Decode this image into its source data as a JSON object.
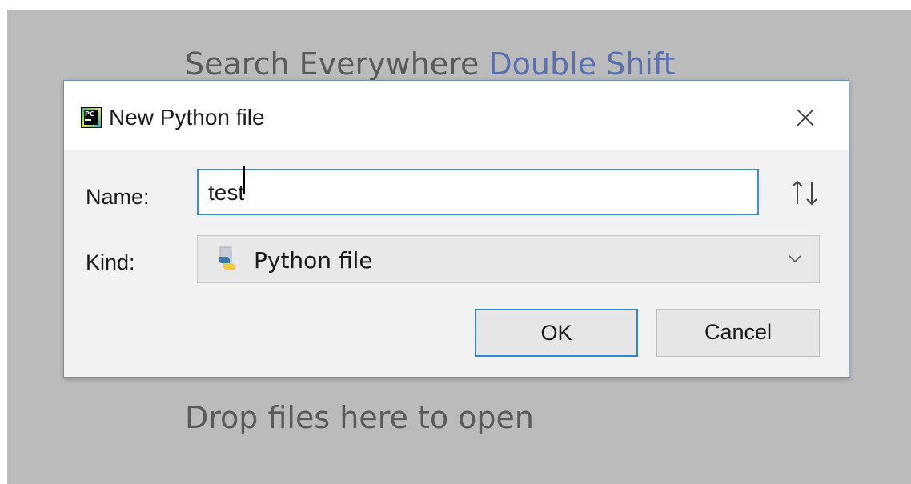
{
  "editor": {
    "search_hint": "Search Everywhere",
    "search_shortcut": "Double Shift",
    "drop_hint": "Drop files here to open"
  },
  "dialog": {
    "title": "New Python file",
    "app_icon": "pycharm-logo-icon",
    "app_icon_text": "PC",
    "close_icon": "close-icon",
    "name_label": "Name:",
    "name_value": "test",
    "sort_icon": "sort-up-down-arrows-icon",
    "kind_label": "Kind:",
    "kind_value": "Python file",
    "kind_icon": "python-file-icon",
    "kind_dropdown_icon": "chevron-down-icon",
    "ok_label": "OK",
    "cancel_label": "Cancel"
  },
  "colors": {
    "editor_background": "#bbbbbb",
    "hint_text": "#5a5a5a",
    "shortcut_text": "#5a6fb0",
    "focus_border": "#3c8fd6",
    "dialog_background": "#f2f2f2"
  }
}
